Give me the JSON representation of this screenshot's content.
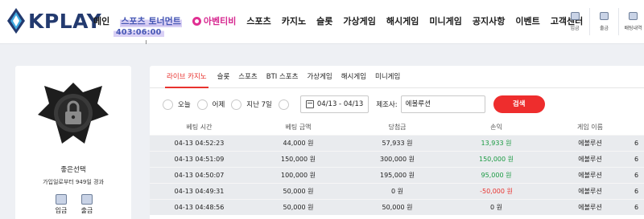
{
  "header": {
    "logo_text": "KPLAY",
    "nav": [
      {
        "label": "메인",
        "style": "normal"
      },
      {
        "label": "스포츠 토너먼트",
        "style": "special"
      },
      {
        "label": "아벤티비",
        "style": "pink"
      },
      {
        "label": "스포츠",
        "style": "normal"
      },
      {
        "label": "카지노",
        "style": "normal"
      },
      {
        "label": "슬롯",
        "style": "normal"
      },
      {
        "label": "가상게임",
        "style": "normal"
      },
      {
        "label": "해시게임",
        "style": "normal"
      },
      {
        "label": "미니게임",
        "style": "normal"
      },
      {
        "label": "공지사항",
        "style": "normal"
      },
      {
        "label": "이벤트",
        "style": "normal"
      },
      {
        "label": "고객센터",
        "style": "normal"
      }
    ],
    "timer": "403:06:00",
    "icons": [
      {
        "label": "입금",
        "icon": "deposit-icon"
      },
      {
        "label": "출금",
        "icon": "withdraw-icon"
      },
      {
        "label": "배팅내역",
        "icon": "bet-history-icon"
      }
    ]
  },
  "profile": {
    "username": "좋은선택",
    "joined": "가입일로부터 949일 경과",
    "buttons": [
      {
        "label": "입금",
        "icon": "deposit-icon"
      },
      {
        "label": "출금",
        "icon": "withdraw-icon"
      }
    ]
  },
  "tabs": [
    "라이브 카지노",
    "슬롯",
    "스포츠",
    "BTI 스포츠",
    "가상게임",
    "해시게임",
    "미니게임"
  ],
  "active_tab": 0,
  "filters": {
    "radios": [
      "오늘",
      "어제",
      "지난 7일"
    ],
    "date_range": "04/13 - 04/13",
    "provider_label": "제조사:",
    "provider_value": "에볼루션",
    "search_button": "검색"
  },
  "table": {
    "headers": [
      "베팅 시간",
      "베팅 금액",
      "당첨금",
      "손익",
      "게임 이름",
      ""
    ],
    "rows": [
      {
        "time": "04-13 04:52:23",
        "bet": "44,000 원",
        "win": "57,933 원",
        "pl": "13,933 원",
        "pl_type": "pos",
        "game": "에볼루션",
        "extra": "6"
      },
      {
        "time": "04-13 04:51:09",
        "bet": "150,000 원",
        "win": "300,000 원",
        "pl": "150,000 원",
        "pl_type": "pos",
        "game": "에볼루션",
        "extra": "6"
      },
      {
        "time": "04-13 04:50:07",
        "bet": "100,000 원",
        "win": "195,000 원",
        "pl": "95,000 원",
        "pl_type": "pos",
        "game": "에볼루션",
        "extra": "6"
      },
      {
        "time": "04-13 04:49:31",
        "bet": "50,000 원",
        "win": "0 원",
        "pl": "-50,000 원",
        "pl_type": "neg",
        "game": "에볼루션",
        "extra": "6"
      },
      {
        "time": "04-13 04:48:56",
        "bet": "50,000 원",
        "win": "50,000 원",
        "pl": "0 원",
        "pl_type": "zero",
        "game": "에볼루션",
        "extra": "6"
      }
    ]
  },
  "colors": {
    "accent_red": "#e8322e",
    "positive_green": "#1a9a42",
    "brand_navy": "#233a6f",
    "pink": "#d6278f"
  }
}
